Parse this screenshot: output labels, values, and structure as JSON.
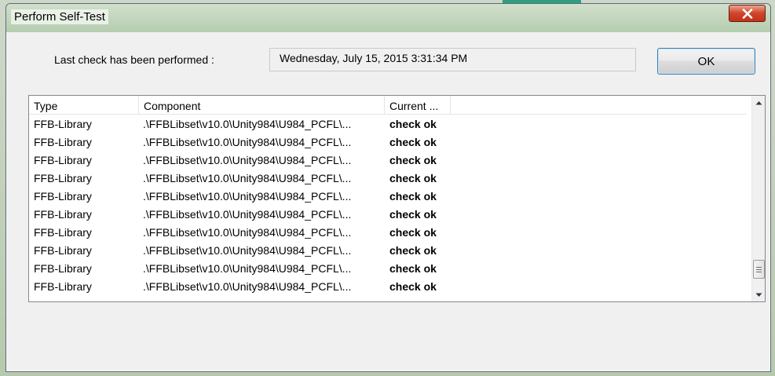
{
  "window": {
    "title": "Perform Self-Test",
    "close_icon": "close-x-icon",
    "close_color": "#c94a2e"
  },
  "last_check": {
    "label": "Last check has been performed :",
    "value": "Wednesday, July 15, 2015  3:31:34 PM"
  },
  "ok_button": {
    "label": "OK"
  },
  "list": {
    "columns": [
      "Type",
      "Component",
      "Current ..."
    ],
    "rows": [
      {
        "type": "FFB-Library",
        "component": ".\\FFBLibset\\v10.0\\Unity984\\U984_PCFL\\...",
        "status": "check ok"
      },
      {
        "type": "FFB-Library",
        "component": ".\\FFBLibset\\v10.0\\Unity984\\U984_PCFL\\...",
        "status": "check ok"
      },
      {
        "type": "FFB-Library",
        "component": ".\\FFBLibset\\v10.0\\Unity984\\U984_PCFL\\...",
        "status": "check ok"
      },
      {
        "type": "FFB-Library",
        "component": ".\\FFBLibset\\v10.0\\Unity984\\U984_PCFL\\...",
        "status": "check ok"
      },
      {
        "type": "FFB-Library",
        "component": ".\\FFBLibset\\v10.0\\Unity984\\U984_PCFL\\...",
        "status": "check ok"
      },
      {
        "type": "FFB-Library",
        "component": ".\\FFBLibset\\v10.0\\Unity984\\U984_PCFL\\...",
        "status": "check ok"
      },
      {
        "type": "FFB-Library",
        "component": ".\\FFBLibset\\v10.0\\Unity984\\U984_PCFL\\...",
        "status": "check ok"
      },
      {
        "type": "FFB-Library",
        "component": ".\\FFBLibset\\v10.0\\Unity984\\U984_PCFL\\...",
        "status": "check ok"
      },
      {
        "type": "FFB-Library",
        "component": ".\\FFBLibset\\v10.0\\Unity984\\U984_PCFL\\...",
        "status": "check ok"
      },
      {
        "type": "FFB-Library",
        "component": ".\\FFBLibset\\v10.0\\Unity984\\U984_PCFL\\...",
        "status": "check ok"
      }
    ],
    "scroll_icons": [
      "scroll-up-arrow-icon",
      "scroll-down-arrow-icon",
      "scroll-grip-icon"
    ]
  }
}
